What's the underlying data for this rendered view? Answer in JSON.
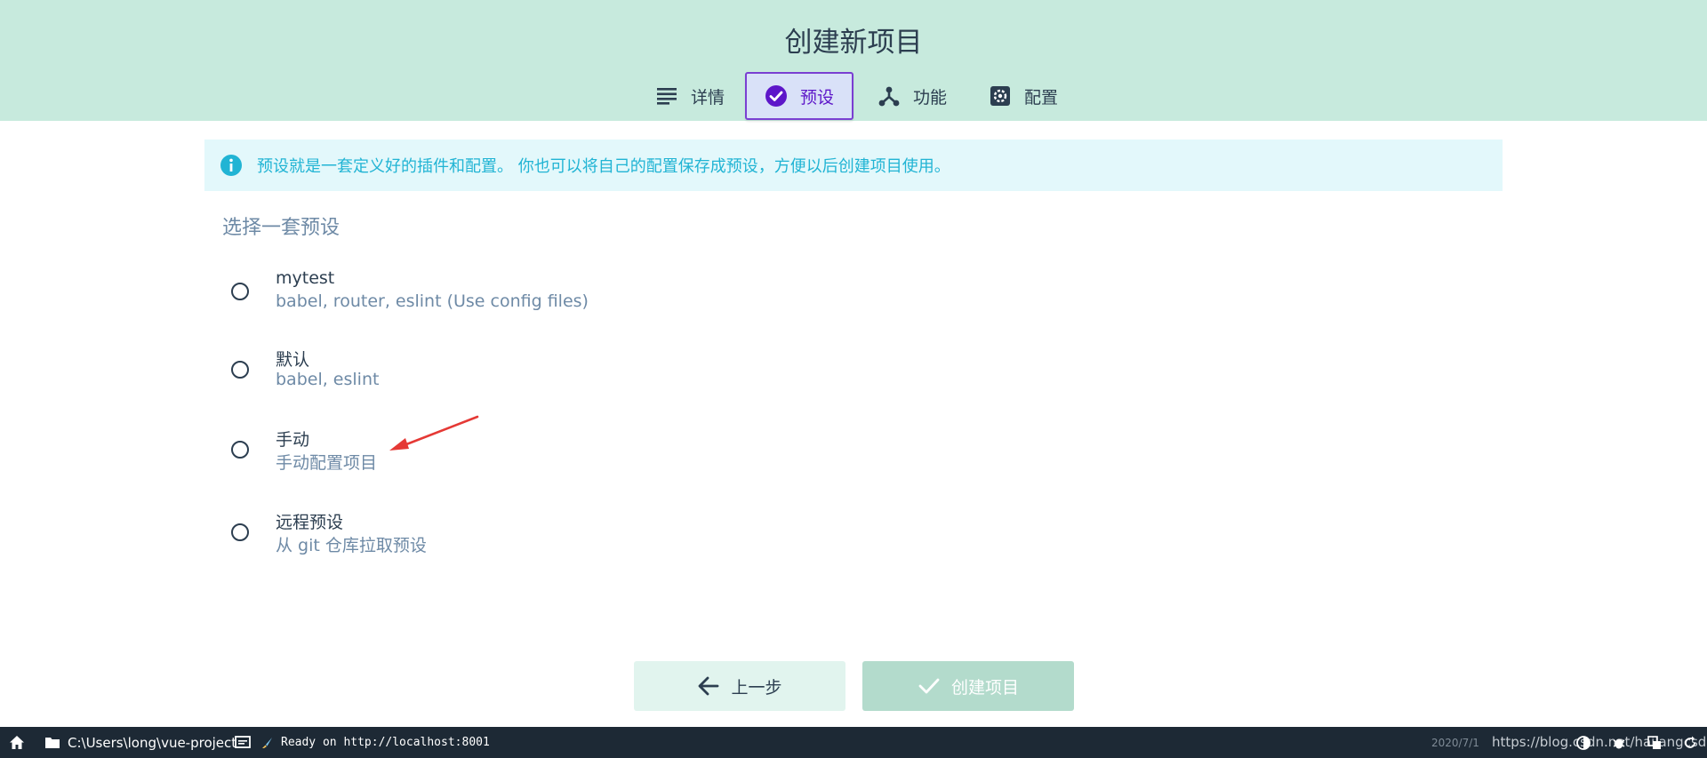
{
  "header": {
    "title": "创建新项目"
  },
  "tabs": [
    {
      "label": "详情",
      "icon": "list-icon"
    },
    {
      "label": "预设",
      "icon": "check-circle-icon"
    },
    {
      "label": "功能",
      "icon": "fork-icon"
    },
    {
      "label": "配置",
      "icon": "gear-icon"
    }
  ],
  "info": {
    "text": "预设就是一套定义好的插件和配置。 你也可以将自己的配置保存成预设，方便以后创建项目使用。"
  },
  "section_title": "选择一套预设",
  "presets": [
    {
      "name": "mytest",
      "desc": "babel, router, eslint (Use config files)"
    },
    {
      "name": "默认",
      "desc": "babel, eslint"
    },
    {
      "name": "手动",
      "desc": "手动配置项目"
    },
    {
      "name": "远程预设",
      "desc": "从 git 仓库拉取预设"
    }
  ],
  "buttons": {
    "prev": "上一步",
    "create": "创建项目"
  },
  "statusbar": {
    "path": "C:\\Users\\long\\vue-project",
    "log": "Ready on http://localhost:8001",
    "date": "2020/7/1",
    "watermark": "https://blog.csdn.net/hailangcsdn"
  },
  "colors": {
    "header_bg": "#c7eadd",
    "active_tab": "#5d16c9",
    "info_text": "#21b4d4",
    "statusbar_bg": "#1d2935",
    "annotation": "#e53935"
  }
}
